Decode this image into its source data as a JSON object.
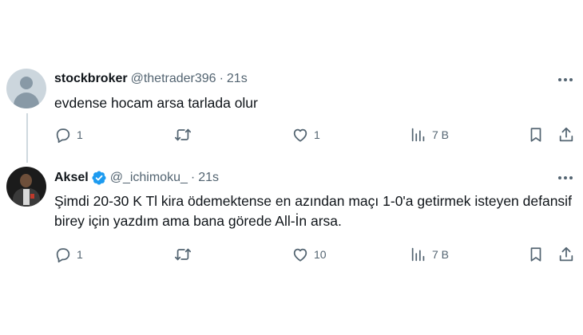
{
  "tweets": [
    {
      "name": "stockbroker",
      "handle": "@thetrader396",
      "separator": "·",
      "time": "21s",
      "verified": false,
      "text": "evdense hocam arsa tarlada olur",
      "replies": "1",
      "retweets": "",
      "likes": "1",
      "views": "7 B"
    },
    {
      "name": "Aksel",
      "handle": "@_ichimoku_",
      "separator": "·",
      "time": "21s",
      "verified": true,
      "text": "Şimdi 20-30 K Tl kira ödemektense en azından maçı 1-0'a getirmek isteyen defansif birey için yazdım ama bana görede All-İn arsa.",
      "replies": "1",
      "retweets": "",
      "likes": "10",
      "views": "7 B"
    }
  ],
  "colors": {
    "text": "#0f1419",
    "secondary": "#536471",
    "verified": "#1d9bf0",
    "thread_line": "#cfd9de"
  },
  "icons": [
    "reply-icon",
    "retweet-icon",
    "like-icon",
    "views-icon",
    "bookmark-icon",
    "share-icon",
    "more-icon",
    "verified-badge-icon"
  ]
}
